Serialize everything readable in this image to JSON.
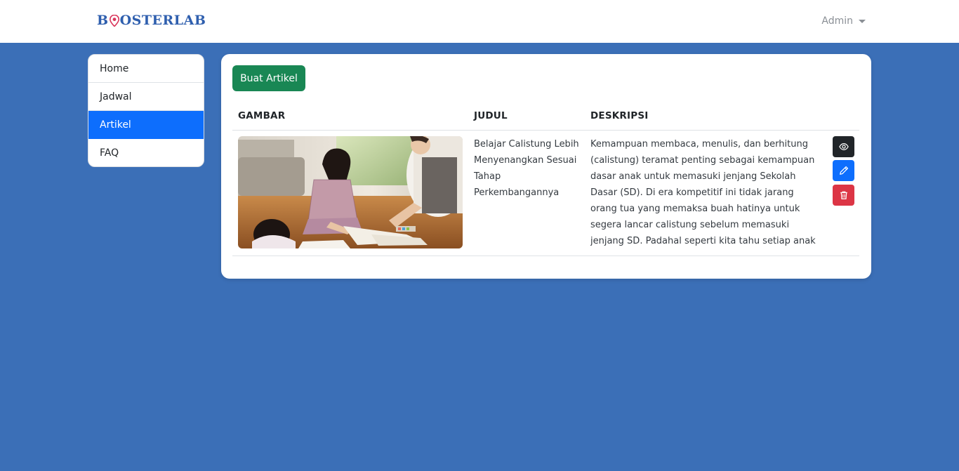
{
  "navbar": {
    "brand_start": "B",
    "brand_end": "OSTERLAB",
    "user_label": "Admin"
  },
  "sidebar": {
    "items": [
      {
        "label": "Home",
        "active": false
      },
      {
        "label": "Jadwal",
        "active": false
      },
      {
        "label": "Artikel",
        "active": true
      },
      {
        "label": "FAQ",
        "active": false
      }
    ]
  },
  "main": {
    "create_button": "Buat Artikel",
    "table": {
      "columns": [
        "GAMBAR",
        "JUDUL",
        "DESKRIPSI"
      ],
      "rows": [
        {
          "image": "photo-children-studying",
          "title": "Belajar Calistung Lebih Menyenangkan Sesuai Tahap Perkembangannya",
          "description": "Kemampuan membaca, menulis, dan berhitung (calistung) teramat penting sebagai kemampuan dasar anak untuk memasuki jenjang Sekolah Dasar (SD). Di era kompetitif ini tidak jarang orang tua yang memaksa buah hatinya untuk segera lancar calistung sebelum memasuki jenjang SD. Padahal seperti kita tahu setiap anak memiliki kemampua..."
        }
      ]
    }
  },
  "icons": {
    "view": "eye-icon",
    "edit": "pencil-icon",
    "delete": "trash-icon"
  },
  "colors": {
    "background": "#3b6fb7",
    "brand": "#2f5fae",
    "active_nav": "#0d6efd",
    "create_button": "#198754",
    "view_button": "#212529",
    "edit_button": "#0d6efd",
    "delete_button": "#dc3545"
  }
}
